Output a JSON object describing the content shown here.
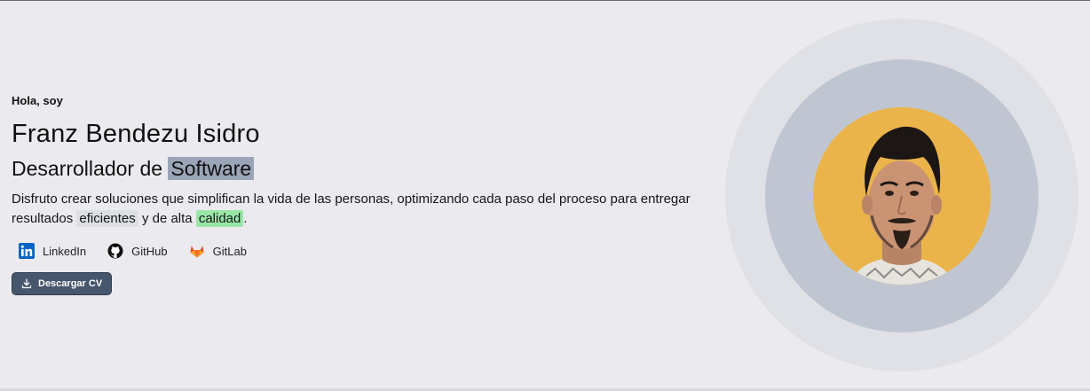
{
  "hero": {
    "greeting": "Hola, soy",
    "name": "Franz Bendezu Isidro",
    "role_prefix": "Desarrollador de",
    "role_highlight": "Software",
    "description_part1": "Disfruto crear soluciones que simplifican la vida de las personas, optimizando cada paso del proceso para entregar resultados",
    "highlight_1": "eficientes",
    "description_part2": "y de alta",
    "highlight_2": "calidad",
    "description_end": "."
  },
  "socials": [
    {
      "label": "LinkedIn",
      "icon": "linkedin-icon",
      "color": "#0a66c2"
    },
    {
      "label": "GitHub",
      "icon": "github-icon",
      "color": "#111111"
    },
    {
      "label": "GitLab",
      "icon": "gitlab-icon",
      "color": "#e24329"
    }
  ],
  "cv_button": {
    "label": "Descargar CV",
    "icon": "download-icon"
  },
  "colors": {
    "background": "#ebebef",
    "role_highlight": "#9aa5b8",
    "chip": "#dcdfe4",
    "chip_green": "#99e6a8",
    "button": "#46566c",
    "photo_bg": "#eab44a"
  },
  "portrait": {
    "icon": "profile-photo"
  }
}
